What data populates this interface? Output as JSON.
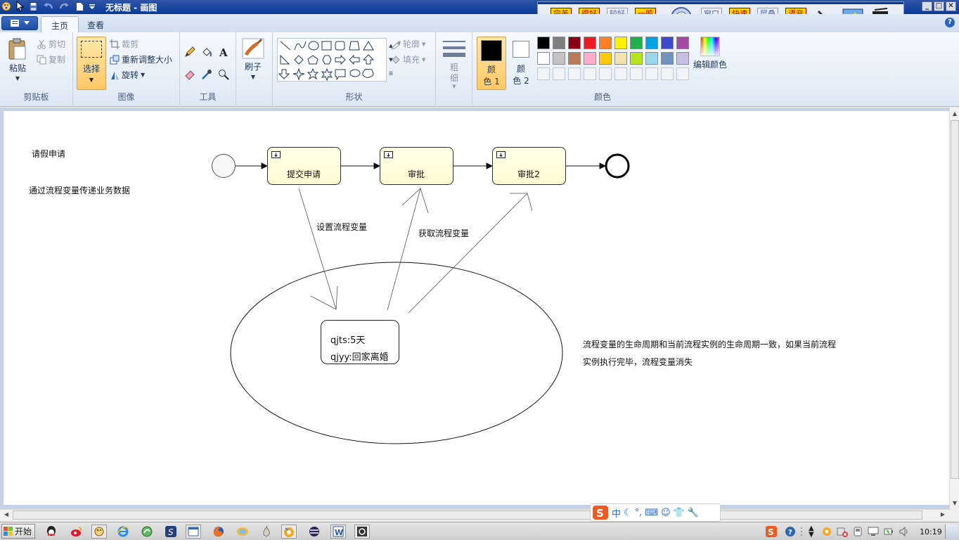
{
  "window": {
    "title": "无标题 - 画图",
    "controls": [
      "_",
      "□",
      "✕"
    ]
  },
  "floatbar": {
    "buttons": [
      {
        "label": "完美\n画质",
        "style": "red"
      },
      {
        "label": "很好\n画质",
        "style": "red"
      },
      {
        "label": "较好\n画质",
        "style": "grey"
      },
      {
        "label": "一般\n画质",
        "style": "red"
      },
      {
        "label": "窗口\n模式",
        "style": "grey"
      },
      {
        "label": "快速\n高效",
        "style": "red"
      },
      {
        "label": "层叠\n窗口",
        "style": "grey"
      },
      {
        "label": "语音\n广播",
        "style": "red"
      }
    ]
  },
  "ribbon": {
    "tabs": [
      "主页",
      "查看"
    ],
    "active_tab": "主页",
    "clipboard": {
      "paste": "粘贴",
      "cut": "剪切",
      "copy": "复制",
      "label": "剪贴板"
    },
    "image": {
      "select": "选择",
      "crop": "裁剪",
      "resize": "重新调整大小",
      "rotate": "旋转",
      "label": "图像"
    },
    "tools": {
      "label": "工具"
    },
    "brushes": {
      "label": "刷子"
    },
    "shapes": {
      "outline": "轮廓",
      "fill": "填充",
      "label": "形状"
    },
    "size": {
      "label": "粗\n细"
    },
    "colors": {
      "color1": "颜\n色 1",
      "color2": "颜\n色 2",
      "edit": "编辑颜色",
      "label": "颜色",
      "palette_row1": [
        "#000000",
        "#7f7f7f",
        "#880015",
        "#ed1c24",
        "#ff7f27",
        "#fff200",
        "#22b14c",
        "#00a2e8",
        "#3f48cc",
        "#a349a4"
      ],
      "palette_row2": [
        "#ffffff",
        "#c3c3c3",
        "#b97a57",
        "#ffaec9",
        "#ffc90e",
        "#efe4b0",
        "#b5e61d",
        "#99d9ea",
        "#7092be",
        "#c8bfe7"
      ]
    }
  },
  "canvas": {
    "title": "请假申请",
    "subtitle": "通过流程变量传递业务数据",
    "tasks": [
      "提交申请",
      "审批",
      "审批2"
    ],
    "set_label": "设置流程变量",
    "get_label": "获取流程变量",
    "variables": [
      "qjts:5天",
      "qjyy:回家离婚"
    ],
    "note_line1": "流程变量的生命周期和当前流程实例的生命周期一致，如果当前流程",
    "note_line2": "实例执行完毕，流程变量消失"
  },
  "ime": {
    "zh": "中"
  },
  "taskbar": {
    "start": "开始",
    "clock": "10:19"
  }
}
